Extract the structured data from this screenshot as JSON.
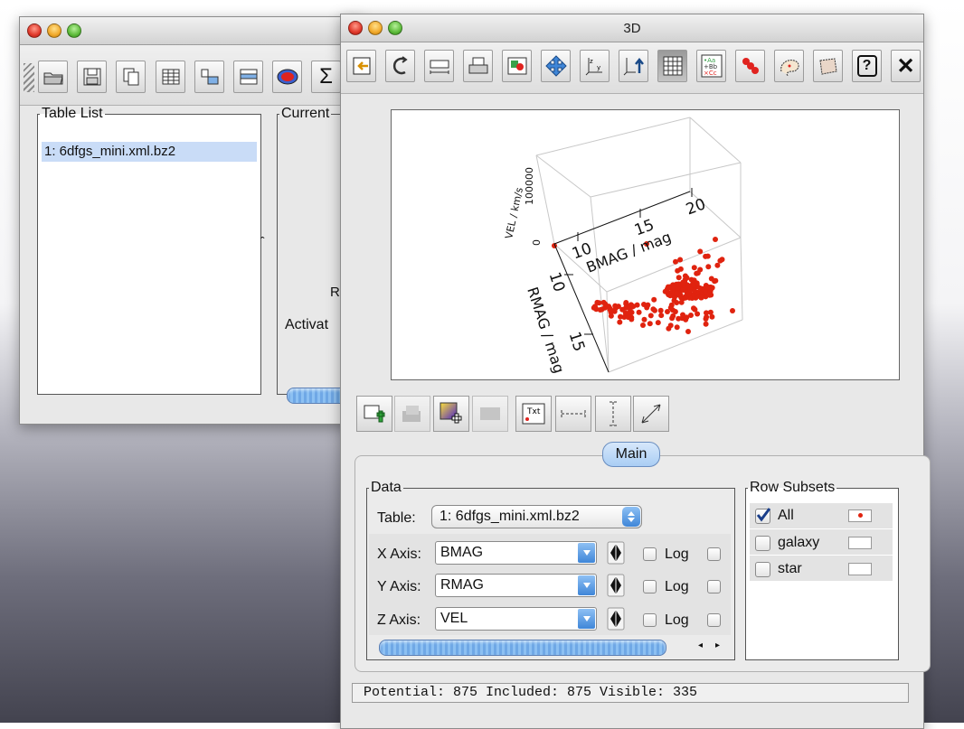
{
  "table_window": {
    "table_list_legend": "Table List",
    "table_item": "1: 6dfgs_mini.xml.bz2",
    "current_legend": "Current",
    "r_label": "R",
    "activat_label": "Activat",
    "toolbar_glyph_sigma": "Σ",
    "divider_caret": "ˆ"
  },
  "plot_window": {
    "title": "3D",
    "help_glyph": "?",
    "close_glyph": "✕",
    "plot": {
      "x_axis_label": "BMAG / mag",
      "y_axis_label": "RMAG / mag",
      "z_axis_label": "VEL / km/s",
      "x_ticks": [
        "10",
        "15",
        "20"
      ],
      "y_ticks": [
        "10",
        "15"
      ],
      "z_ticks": [
        "0",
        "100000"
      ],
      "point_color": "#e0230f"
    },
    "tab_main": "Main",
    "data_legend": "Data",
    "table_label": "Table:",
    "table_value": "1: 6dfgs_mini.xml.bz2",
    "axes": [
      {
        "label": "X Axis:",
        "value": "BMAG",
        "log_label": "Log"
      },
      {
        "label": "Y Axis:",
        "value": "RMAG",
        "log_label": "Log"
      },
      {
        "label": "Z Axis:",
        "value": "VEL",
        "log_label": "Log"
      }
    ],
    "row_subsets_legend": "Row Subsets",
    "subsets": [
      {
        "label": "All",
        "checked": true
      },
      {
        "label": "galaxy",
        "checked": false
      },
      {
        "label": "star",
        "checked": false
      }
    ],
    "status_text": "Potential: 875 Included: 875 Visible: 335"
  }
}
